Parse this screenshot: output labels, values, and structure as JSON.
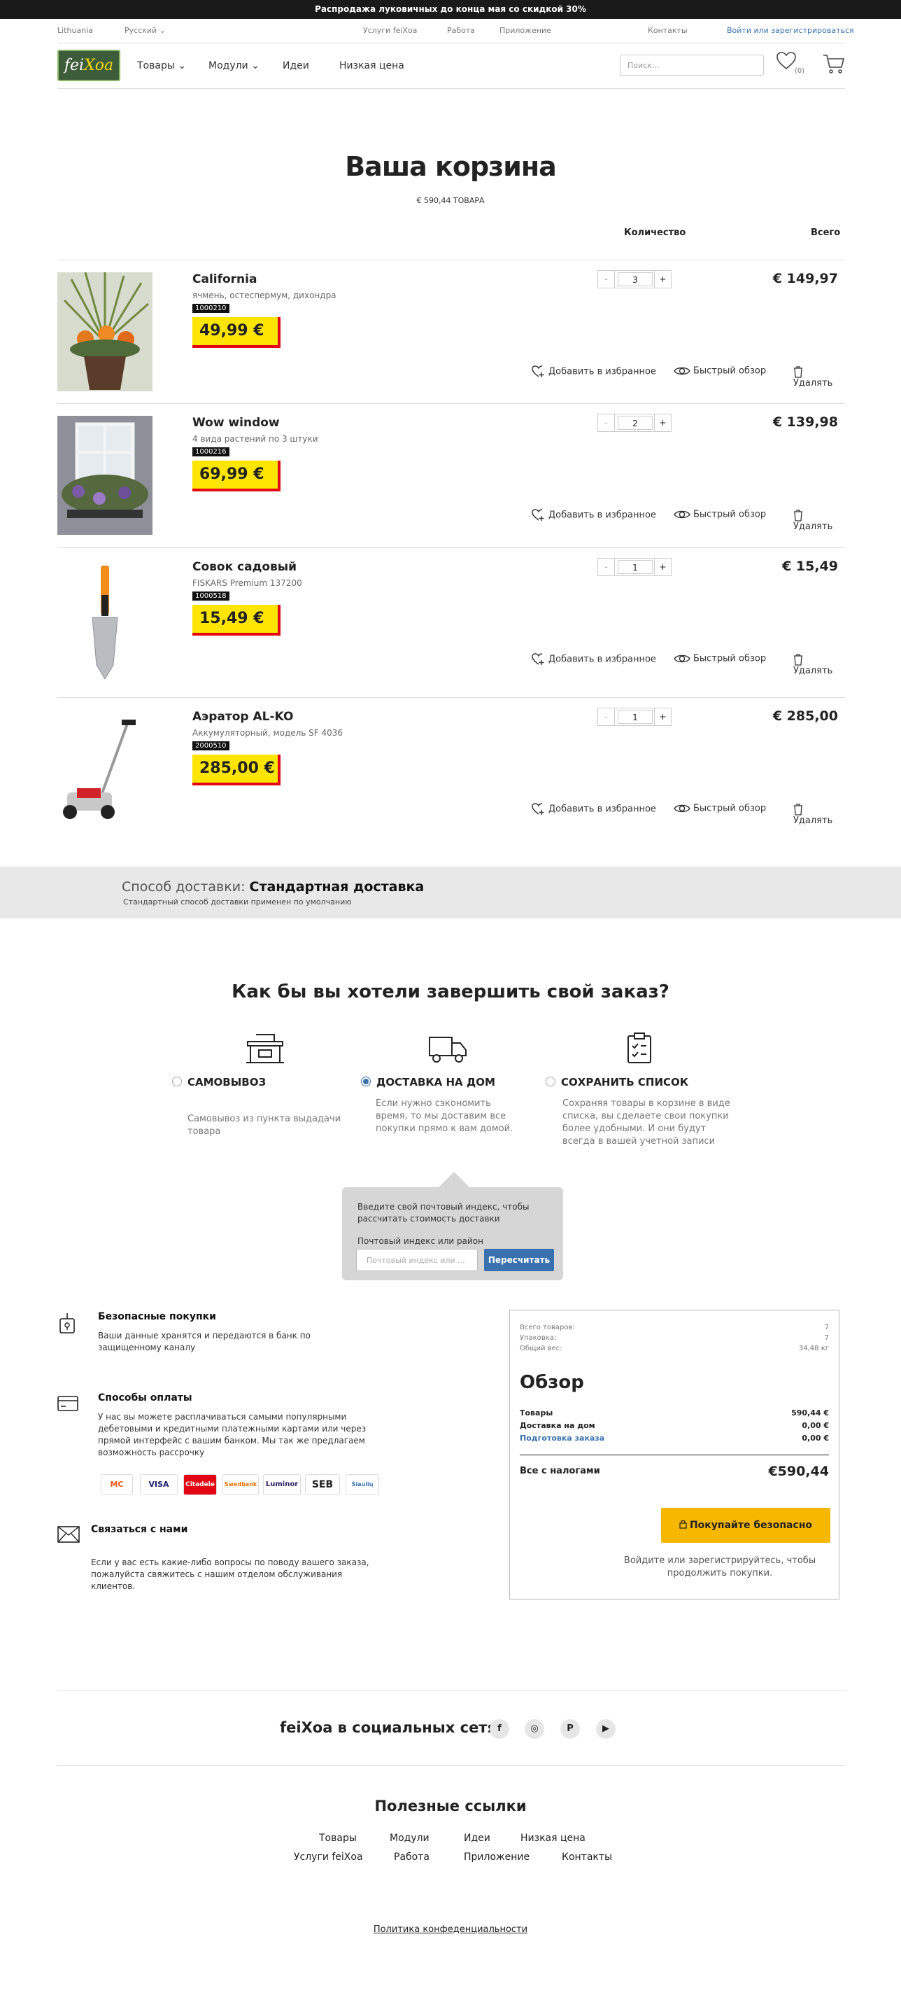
{
  "promo": "Распродажа луковичных до конца мая со скидкой 30%",
  "top": {
    "country": "Lithuania",
    "language": "Русский",
    "links": [
      "Услуги feiXoa",
      "Работа",
      "Приложение",
      "Контакты"
    ],
    "login": "Войти или зарегистрироваться"
  },
  "header": {
    "logo_a": "fei",
    "logo_b": "Xoa",
    "nav": [
      "Товары",
      "Модули",
      "Идеи",
      "Низкая цена"
    ],
    "search_placeholder": "Поиск...",
    "wishlist_count": "(0)"
  },
  "cart": {
    "title": "Ваша корзина",
    "subtitle": "€ 590,44 ТОВАРА",
    "col_qty": "Количество",
    "col_total": "Всего",
    "actions": {
      "fav": "Добавить в избранное",
      "quick": "Быстрый обзор",
      "del": "Удалять"
    },
    "items": [
      {
        "name": "California",
        "desc": "ячмень, остеспермум, дихондра",
        "code": "1000210",
        "price": "49,99 €",
        "qty": "3",
        "total": "€ 149,97"
      },
      {
        "name": "Wow window",
        "desc": "4 вида растений по 3 штуки",
        "code": "1000216",
        "price": "69,99 €",
        "qty": "2",
        "total": "€ 139,98"
      },
      {
        "name": "Совок садовый",
        "desc": "FISKARS Premium 137200",
        "code": "1000518",
        "price": "15,49 €",
        "qty": "1",
        "total": "€ 15,49"
      },
      {
        "name": "Аэратор AL-KO",
        "desc": "Аккумуляторный, модель SF 4036",
        "code": "2000510",
        "price": "285,00 €",
        "qty": "1",
        "total": "€ 285,00"
      }
    ]
  },
  "delivery": {
    "label": "Способ доставки: ",
    "value": "Стандартная доставка",
    "note": "Стандартный способ доставки применен по умолчанию"
  },
  "checkout": {
    "title": "Как бы вы хотели завершить свой заказ?",
    "options": [
      {
        "label": "САМОВЫВОЗ",
        "desc": "Самовывоз из пункта выдадачи товара",
        "selected": false
      },
      {
        "label": "ДОСТАВКА НА ДОМ",
        "desc": "Если нужно сэкономить время, то мы доставим все покупки прямо к вам домой.",
        "selected": true
      },
      {
        "label": "СОХРАНИТЬ СПИСОК",
        "desc": "Сохраняя товары в корзине в виде списка, вы сделаете свои покупки более удобными. И они будут всегда в вашей учетной записи",
        "selected": false
      }
    ],
    "zip_info": "Введите свой почтовый индекс, чтобы рассчитать стоимость доставки",
    "zip_label": "Почтовый индекс или район",
    "zip_placeholder": "Почтовый индекс или ...",
    "zip_button": "Пересчитать"
  },
  "info": {
    "secure_title": "Безопасные покупки",
    "secure_text": "Ваши данные хранятся и передаются в банк по защищенному каналу",
    "pay_title": "Способы оплаты",
    "pay_text": "У нас вы можете расплачиваться самыми популярными дебетовыми и кредитными платежными картами или через прямой интерфейс с вашим банком. Мы так же предлагаем возможность рассрочку",
    "pay_logos": [
      "MC",
      "VISA",
      "Citadele",
      "Swedbank",
      "Luminor",
      "SEB",
      "Šiaulių"
    ],
    "contact_title": "Связаться с нами",
    "contact_text": "Если у вас есть какие-либо вопросы по поводу вашего заказа, пожалуйста свяжитесь с нашим отделом обслуживания клиентов."
  },
  "summary": {
    "items_l": "Всего товаров:",
    "items_v": "7",
    "pack_l": "Упаковка:",
    "pack_v": "7",
    "weight_l": "Общий вес:",
    "weight_v": "34,48 кг",
    "title": "Обзор",
    "goods_l": "Товары",
    "goods_v": "590,44 €",
    "home_l": "Доставка на дом",
    "home_v": "0,00 €",
    "prep_l": "Подготовка заказа",
    "prep_v": "0,00 €",
    "total_l": "Все с налогами",
    "total_v": "€590,44",
    "buy": "Покупайте безопасно",
    "note": "Войдите или зарегистрируйтесь, чтобы продолжить покупки."
  },
  "footer": {
    "social": "feiXoa в социальных сетях",
    "useful": "Полезные ссылки",
    "links": [
      "Товары",
      "Модули",
      "Идеи",
      "Низкая цена",
      "Услуги feiXoa",
      "Работа",
      "Приложение",
      "Контакты"
    ],
    "privacy": "Политика конфеденциальности"
  }
}
